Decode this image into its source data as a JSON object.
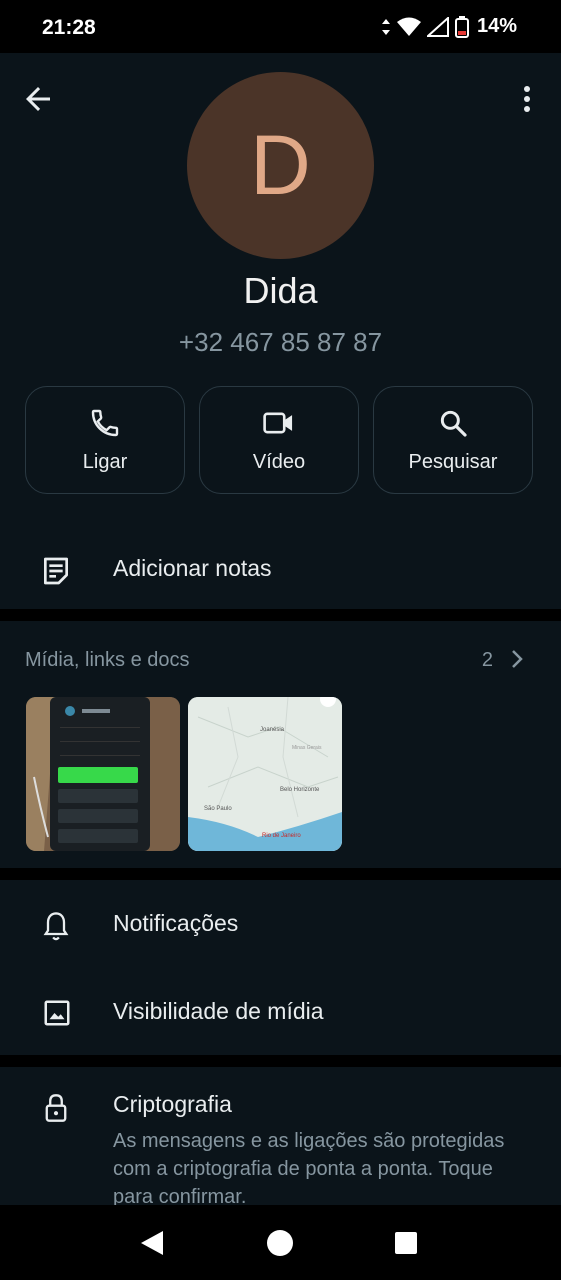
{
  "status_bar": {
    "time": "21:28",
    "battery": "14%"
  },
  "header": {
    "back_icon": "arrow-back-icon",
    "menu_icon": "more-vert-icon"
  },
  "contact": {
    "avatar_letter": "D",
    "name": "Dida",
    "phone": "+32 467 85 87 87",
    "avatar_color": "#4b3428",
    "avatar_text_color": "#e0a887"
  },
  "actions": [
    {
      "label": "Ligar",
      "icon": "phone-icon"
    },
    {
      "label": "Vídeo",
      "icon": "video-icon"
    },
    {
      "label": "Pesquisar",
      "icon": "search-icon"
    }
  ],
  "notes": {
    "label": "Adicionar notas",
    "icon": "note-icon"
  },
  "media": {
    "title": "Mídia, links e docs",
    "count": "2",
    "thumbnails": [
      {
        "icon": "photo-thumbnail"
      },
      {
        "icon": "map-thumbnail",
        "labels": [
          "Joanésia",
          "Minas Gerais",
          "Belo Horizonte",
          "São Paulo",
          "Rio de Janeiro"
        ]
      }
    ]
  },
  "settings": {
    "notifications": "Notificações",
    "media_visibility": "Visibilidade de mídia"
  },
  "encryption": {
    "title": "Criptografia",
    "description": "As mensagens e as ligações são protegidas com a criptografia de ponta a ponta. Toque para confirmar."
  },
  "colors": {
    "background": "#0b141a",
    "border": "#2a3942",
    "secondary_text": "#8696a0"
  }
}
